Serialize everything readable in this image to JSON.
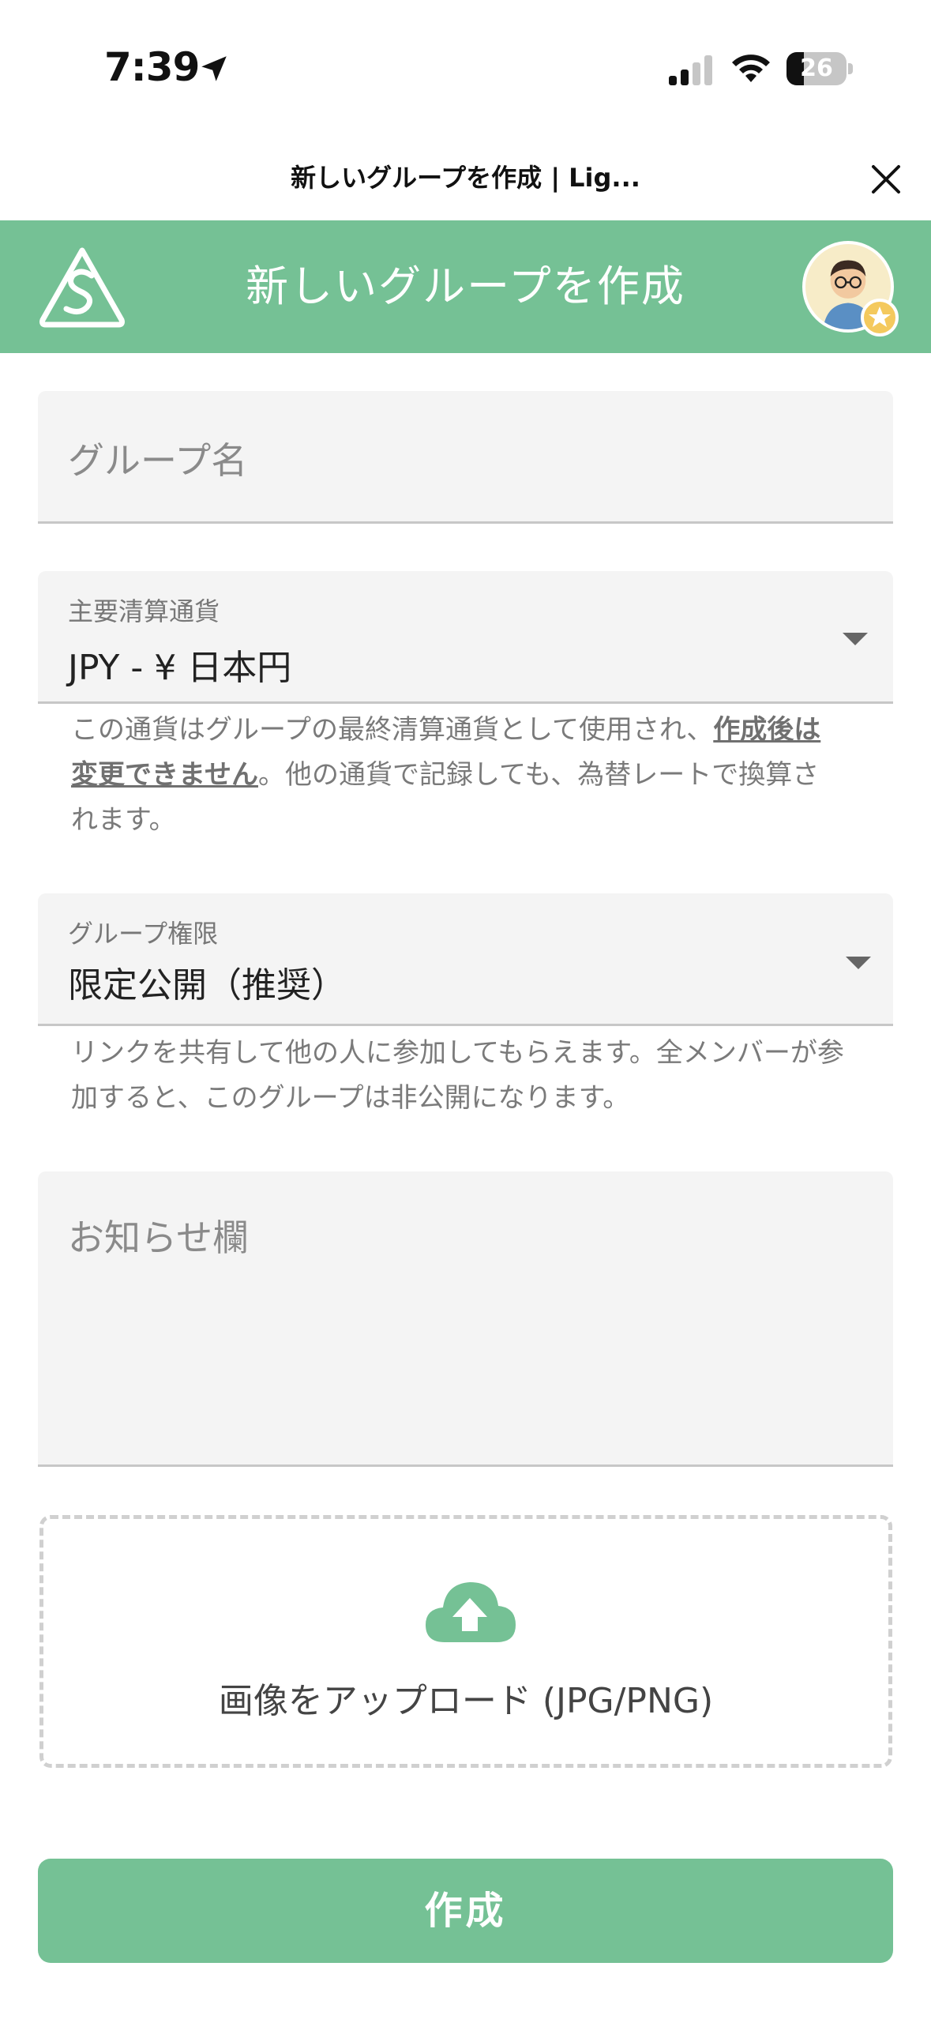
{
  "status_bar": {
    "time": "7:39",
    "battery_level": "26",
    "icons": [
      "location-arrow-icon",
      "cellular-signal-icon",
      "wifi-icon",
      "battery-icon"
    ]
  },
  "sheet": {
    "title": "新しいグループを作成 | Lig...",
    "close_icon": "close-icon"
  },
  "header": {
    "title": "新しいグループを作成",
    "logo_icon": "app-logo-icon",
    "avatar_icon": "user-avatar-icon"
  },
  "form": {
    "group_name": {
      "placeholder": "グループ名",
      "value": ""
    },
    "currency": {
      "label": "主要清算通貨",
      "value": "JPY - ¥ 日本円",
      "helper_prefix": "この通貨はグループの最終清算通貨として使用され、",
      "helper_strong": "作成後は変更できません",
      "helper_suffix": "。他の通貨で記録しても、為替レートで換算されます。"
    },
    "permission": {
      "label": "グループ権限",
      "value": "限定公開（推奨）",
      "helper": "リンクを共有して他の人に参加してもらえます。全メンバーが参加すると、このグループは非公開になります。"
    },
    "notice": {
      "placeholder": "お知らせ欄",
      "value": ""
    },
    "upload": {
      "label": "画像をアップロード (JPG/PNG)",
      "icon": "cloud-upload-icon"
    },
    "submit_label": "作成"
  },
  "colors": {
    "brand_green": "#75c195",
    "field_bg": "#f4f4f4"
  }
}
